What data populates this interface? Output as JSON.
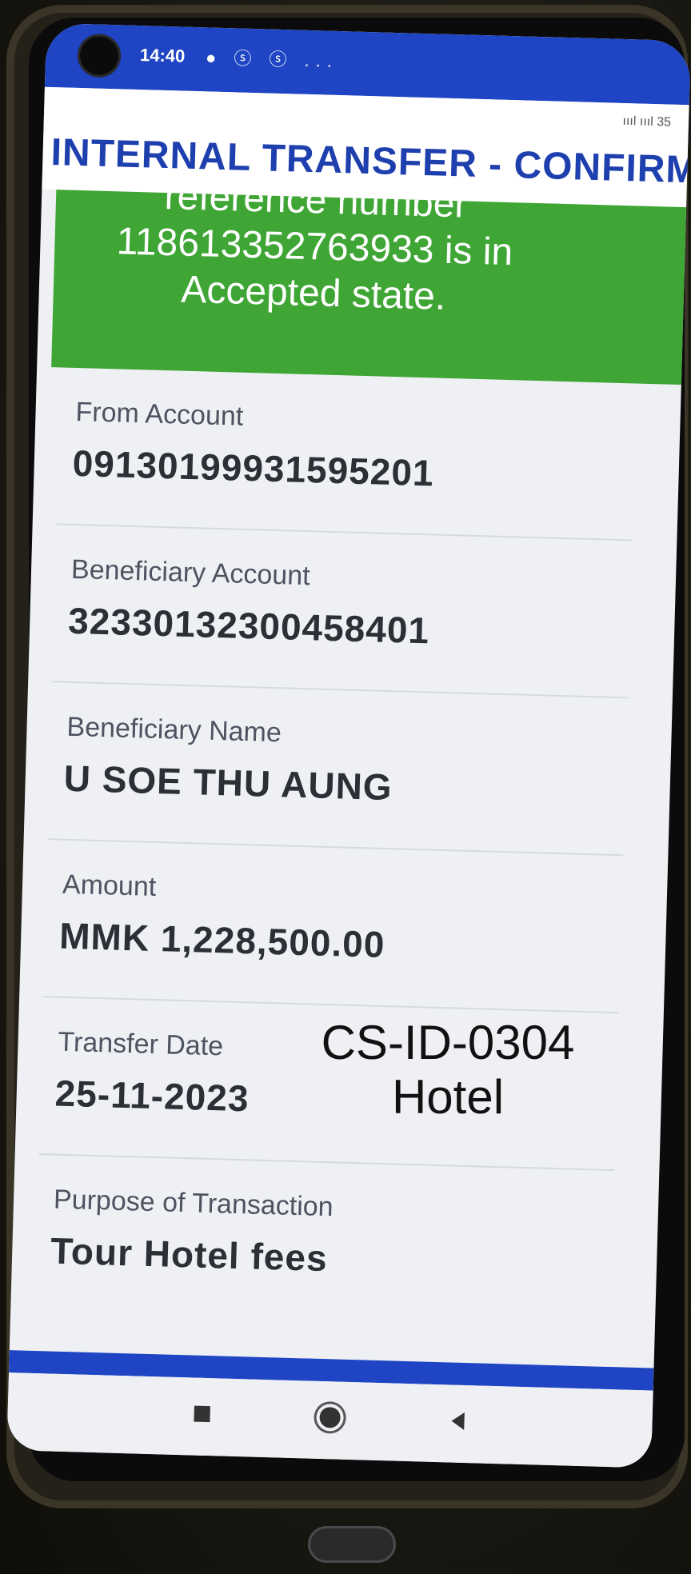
{
  "status_bar": {
    "time": "14:40",
    "notification_icons": "● ⓢ ⓢ ...",
    "right_indicators": "ıııl ıııl 35"
  },
  "header": {
    "title": "INTERNAL TRANSFER - CONFIRM"
  },
  "banner": {
    "text_line1": "reference number",
    "text_line2": "118613352763933 is in",
    "text_line3": "Accepted state."
  },
  "details": [
    {
      "label": "From Account",
      "value": "09130199931595201"
    },
    {
      "label": "Beneficiary Account",
      "value": "32330132300458401"
    },
    {
      "label": "Beneficiary Name",
      "value": "U SOE THU AUNG"
    },
    {
      "label": "Amount",
      "value": "MMK 1,228,500.00"
    },
    {
      "label": "Transfer Date",
      "value": "25-11-2023"
    },
    {
      "label": "Purpose of Transaction",
      "value": "Tour Hotel fees"
    }
  ],
  "overlay": {
    "line1": "CS-ID-0304",
    "line2": "Hotel"
  },
  "colors": {
    "header_blue": "#1f45c4",
    "banner_green": "#3fa635"
  }
}
